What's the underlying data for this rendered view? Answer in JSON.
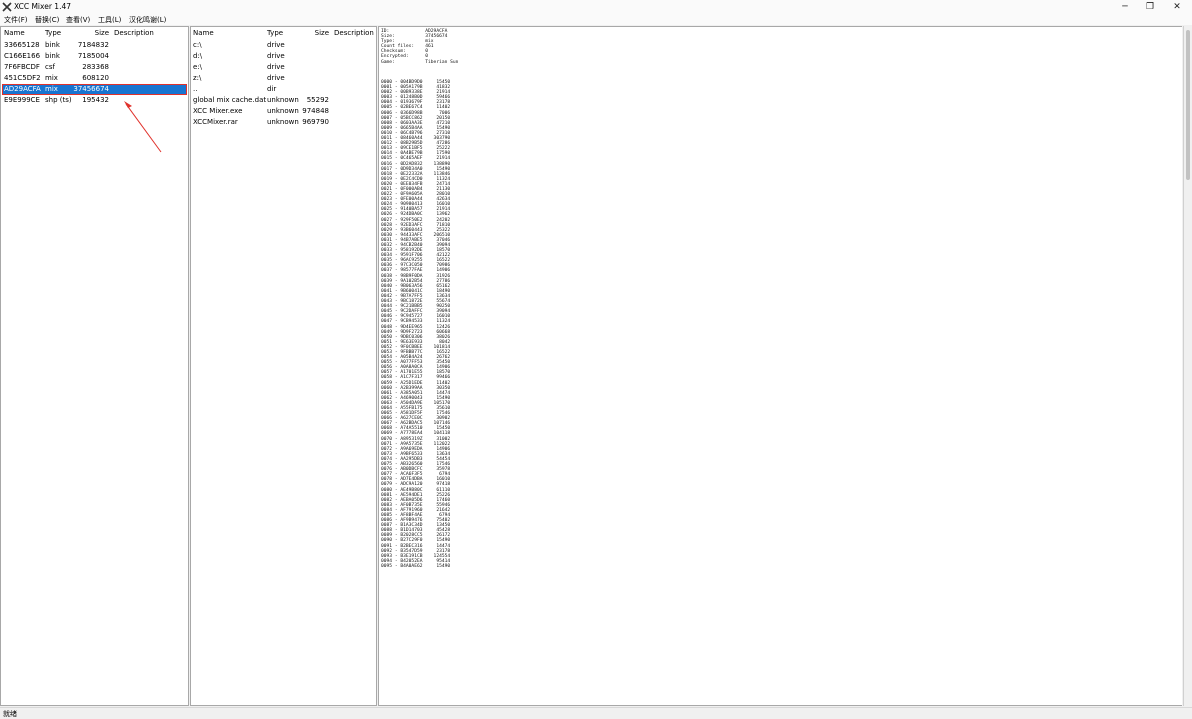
{
  "window": {
    "title": "XCC Mixer 1.47",
    "minimize": "─",
    "maximize": "❐",
    "close": "✕"
  },
  "menu": [
    "文件(F)",
    "替换(C)",
    "查看(V)",
    "工具(L)",
    "汉化鸣谢(L)"
  ],
  "left_pane": {
    "columns": [
      "Name",
      "Type",
      "Size",
      "Description"
    ],
    "rows": [
      {
        "name": "33665128",
        "type": "bink",
        "size": "7184832",
        "desc": ""
      },
      {
        "name": "C166E166",
        "type": "bink",
        "size": "7185004",
        "desc": ""
      },
      {
        "name": "7F6FBCDF",
        "type": "csf",
        "size": "283368",
        "desc": ""
      },
      {
        "name": "451C5DF2",
        "type": "mix",
        "size": "608120",
        "desc": ""
      },
      {
        "name": "AD29ACFA",
        "type": "mix",
        "size": "37456674",
        "desc": ""
      },
      {
        "name": "E9E999CE",
        "type": "shp (ts)",
        "size": "195432",
        "desc": ""
      }
    ]
  },
  "mid_pane": {
    "columns": [
      "Name",
      "Type",
      "Size",
      "Description"
    ],
    "rows": [
      {
        "name": "c:\\",
        "type": "drive",
        "size": "",
        "desc": ""
      },
      {
        "name": "d:\\",
        "type": "drive",
        "size": "",
        "desc": ""
      },
      {
        "name": "e:\\",
        "type": "drive",
        "size": "",
        "desc": ""
      },
      {
        "name": "z:\\",
        "type": "drive",
        "size": "",
        "desc": ""
      },
      {
        "name": "..",
        "type": "dir",
        "size": "",
        "desc": ""
      },
      {
        "name": "global mix cache.dat",
        "type": "unknown",
        "size": "55292",
        "desc": ""
      },
      {
        "name": "XCC Mixer.exe",
        "type": "unknown",
        "size": "974848",
        "desc": ""
      },
      {
        "name": "XCCMixer.rar",
        "type": "unknown",
        "size": "969790",
        "desc": ""
      }
    ]
  },
  "info_pane": {
    "header": "ID:             AD29ACFA\nSize:           37456674\nType:           mix\nCount files:    461\nChecksum:       0\nEncrypted:      0\nGame:           Tiberian Sun",
    "listing": "0000 - 004BD9D0     15450\n0001 - 005A179B     41832\n0002 - 00B9338E     21914\n0003 - 01248B0D     59466\n0004 - 0193679F     23178\n0005 - 02BE67C4     11402\n0006 - 0366D98B      7006\n0007 - 05BCC862     20150\n0008 - 0603AA3E     47210\n0009 - 0665B4AA     15490\n0010 - 06C4B796     27310\n0011 - 08460A44    303790\n0012 - 08B29B5D     47286\n0013 - 09CE1BF5     25222\n0014 - 0A4BE79B     17590\n0015 - 0C465AEF     21914\n0016 - 0D2AD832    138890\n0017 - 0D9D34A0     15490\n0018 - 0E22332A    113846\n0019 - 0E2C4CD0     11324\n0020 - 0EE034FB     24714\n0021 - 0F000AB4     21130\n0022 - 0F9A605A     28010\n0023 - 0FE00A44     42634\n0024 - 90980413     16010\n0025 - 9140BA57     21914\n0026 - 924DBA0C     13962\n0027 - 929F50E2     24202\n0028 - 92ED3AFC     71810\n0029 - 93B60443     25322\n0030 - 94433AFC    206510\n0031 - 94B7ABE5     37046\n0032 - 94CB2B40     39094\n0033 - 958192DE     18570\n0034 - 9591F706     42122\n0035 - 96AC9255     16522\n0036 - 97C3C050     70986\n0037 - 98577FAE     14906\n0038 - 98B9F0DA     31926\n0039 - 9A102B54     27786\n0040 - 9B063A56     65162\n0041 - 9B60041C     18490\n0042 - 9B7A7FF5     13634\n0043 - 9BC1872E     55674\n0044 - 9C21BBB5     90250\n0045 - 9C2DAFFC     39094\n0046 - 9C945727     16010\n0047 - 9CB94533     11324\n0048 - 9D4EE965     12426\n0049 - 9D9F2723     60668\n0050 - 9DBC0306     38026\n0051 - 9E63E933      8042\n0052 - 9F0CBBEE    101814\n0053 - 9FBBB77C     16522\n0054 - A05B4A24     26762\n0055 - A077FF53     35450\n0056 - A0A8A0CA     14906\n0057 - A1701E55     18570\n0058 - A1C7F317     99466\n0059 - A25D1EDE     11402\n0060 - A2B399AA     30350\n0061 - A385A051     14474\n0062 - A4690043     15490\n0063 - A504DA9E    105170\n0064 - A55FB175     35610\n0065 - A581DF5F     17546\n0066 - A627CE0C     30902\n0067 - A62BDAC5    107146\n0068 - A74A5510     15450\n0069 - A7778EA4    104118\n0070 - A895319Z     31002\n0071 - A9A5735E    112022\n0072 - A9A69EDA     14906\n0073 - A9BF6533     13634\n0074 - AA295DB3     54454\n0075 - AB326560     17546\n0076 - AB0DBCFC     35978\n0077 - ACA6F3F5      6794\n0078 - AD7E4DBA     16010\n0079 - ADC9A120     97418\n0080 - AE49B80C     61110\n0081 - AE594DE1     25226\n0082 - AEBA05D6     17460\n0083 - AF0B735E     55946\n0084 - AF791960     21642\n0085 - AF8BF4AE      6794\n0086 - AF9B9476     75402\n0087 - B1A3C34D     13450\n0088 - B1D14703     45428\n0089 - B2028CC5     26172\n0090 - B27C29F0     15490\n0091 - B2BEC316     14474\n0092 - B3547D59     23178\n0093 - B3E191CB    124554\n0094 - B42052EA     95414\n0095 - B4A0AE62     15490"
  },
  "status": {
    "text": "就绪"
  },
  "colors": {
    "selection": "#1874d0",
    "annotation": "#e0312b"
  }
}
